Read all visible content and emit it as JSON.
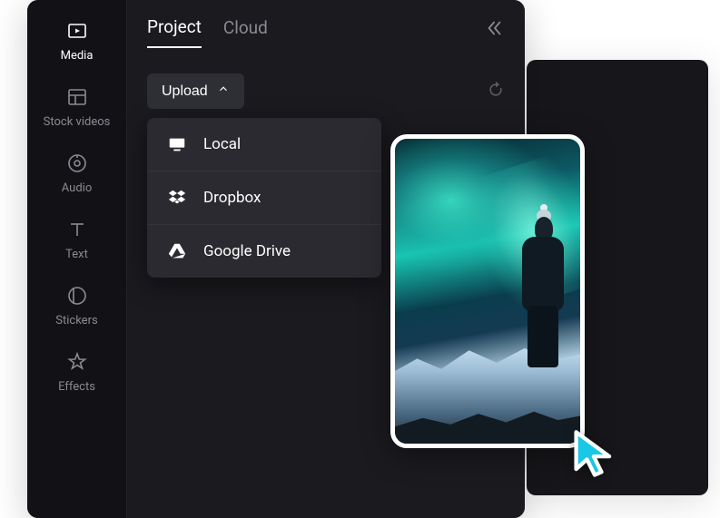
{
  "sidebar": {
    "items": [
      {
        "label": "Media"
      },
      {
        "label": "Stock videos"
      },
      {
        "label": "Audio"
      },
      {
        "label": "Text"
      },
      {
        "label": "Stickers"
      },
      {
        "label": "Effects"
      }
    ]
  },
  "tabs": {
    "items": [
      {
        "label": "Project"
      },
      {
        "label": "Cloud"
      }
    ]
  },
  "upload": {
    "label": "Upload"
  },
  "upload_menu": {
    "items": [
      {
        "label": "Local",
        "icon": "monitor-icon"
      },
      {
        "label": "Dropbox",
        "icon": "dropbox-icon"
      },
      {
        "label": "Google Drive",
        "icon": "google-drive-icon"
      }
    ]
  },
  "colors": {
    "accent": "#18c8e4",
    "bg_dark": "#1a1a1f",
    "bg_sidebar": "#121216",
    "text_muted": "#8a8a91"
  }
}
